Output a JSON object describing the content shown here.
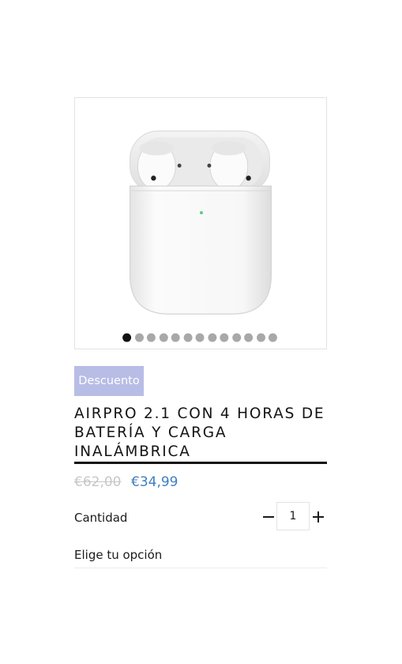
{
  "product": {
    "badge": "Descuento",
    "title": "AIRPRO 2.1 CON 4 HORAS DE BATERÍA Y CARGA INALÁMBRICA",
    "price_old": "€62,00",
    "price_new": "€34,99",
    "image_icon": "earbuds-charging-case-photo"
  },
  "gallery": {
    "slide_count": 13,
    "active_slide": 1
  },
  "quantity": {
    "label": "Cantidad",
    "value": "1"
  },
  "options": {
    "label": "Elige tu opción"
  },
  "colors": {
    "badge_bg": "#b8bde6",
    "price_new": "#3f7ec2",
    "price_old": "#c7c7c7",
    "dot_active": "#111111",
    "dot_inactive": "#a8a8a8"
  }
}
